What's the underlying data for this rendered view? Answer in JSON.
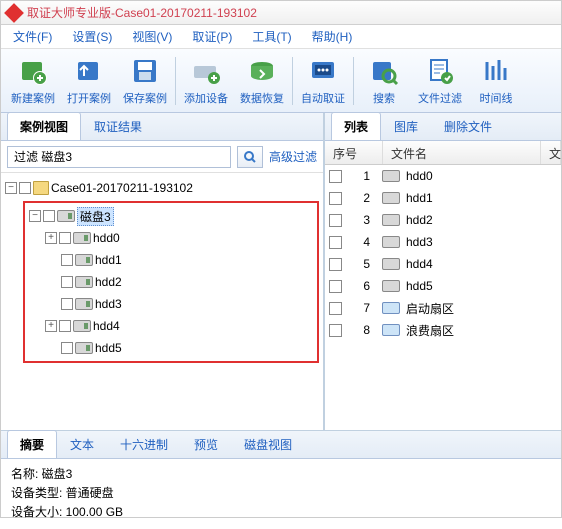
{
  "window": {
    "title": "取证大师专业版-Case01-20170211-193102"
  },
  "menu": [
    "文件(F)",
    "设置(S)",
    "视图(V)",
    "取证(P)",
    "工具(T)",
    "帮助(H)"
  ],
  "toolbar": {
    "items": [
      "新建案例",
      "打开案例",
      "保存案例",
      "添加设备",
      "数据恢复",
      "自动取证",
      "搜索",
      "文件过滤",
      "时间线"
    ]
  },
  "left": {
    "tabs": [
      "案例视图",
      "取证结果"
    ],
    "filter_value": "过滤 磁盘3",
    "adv": "高级过滤",
    "root": "Case01-20170211-193102",
    "sel": "磁盘3",
    "children": [
      "hdd0",
      "hdd1",
      "hdd2",
      "hdd3",
      "hdd4",
      "hdd5"
    ]
  },
  "right": {
    "tabs": [
      "列表",
      "图库",
      "删除文件"
    ],
    "cols": {
      "c0": "序号",
      "c1": "文件名",
      "c2": "文"
    },
    "rows": [
      {
        "n": "1",
        "name": "hdd0",
        "t": "disk"
      },
      {
        "n": "2",
        "name": "hdd1",
        "t": "disk"
      },
      {
        "n": "3",
        "name": "hdd2",
        "t": "disk"
      },
      {
        "n": "4",
        "name": "hdd3",
        "t": "disk"
      },
      {
        "n": "5",
        "name": "hdd4",
        "t": "disk"
      },
      {
        "n": "6",
        "name": "hdd5",
        "t": "disk"
      },
      {
        "n": "7",
        "name": "启动扇区",
        "t": "sys"
      },
      {
        "n": "8",
        "name": "浪费扇区",
        "t": "sys"
      }
    ]
  },
  "bottom": {
    "tabs": [
      "摘要",
      "文本",
      "十六进制",
      "预览",
      "磁盘视图"
    ],
    "lines": [
      "名称: 磁盘3",
      "设备类型: 普通硬盘",
      "设备大小: 100.00 GB"
    ]
  }
}
